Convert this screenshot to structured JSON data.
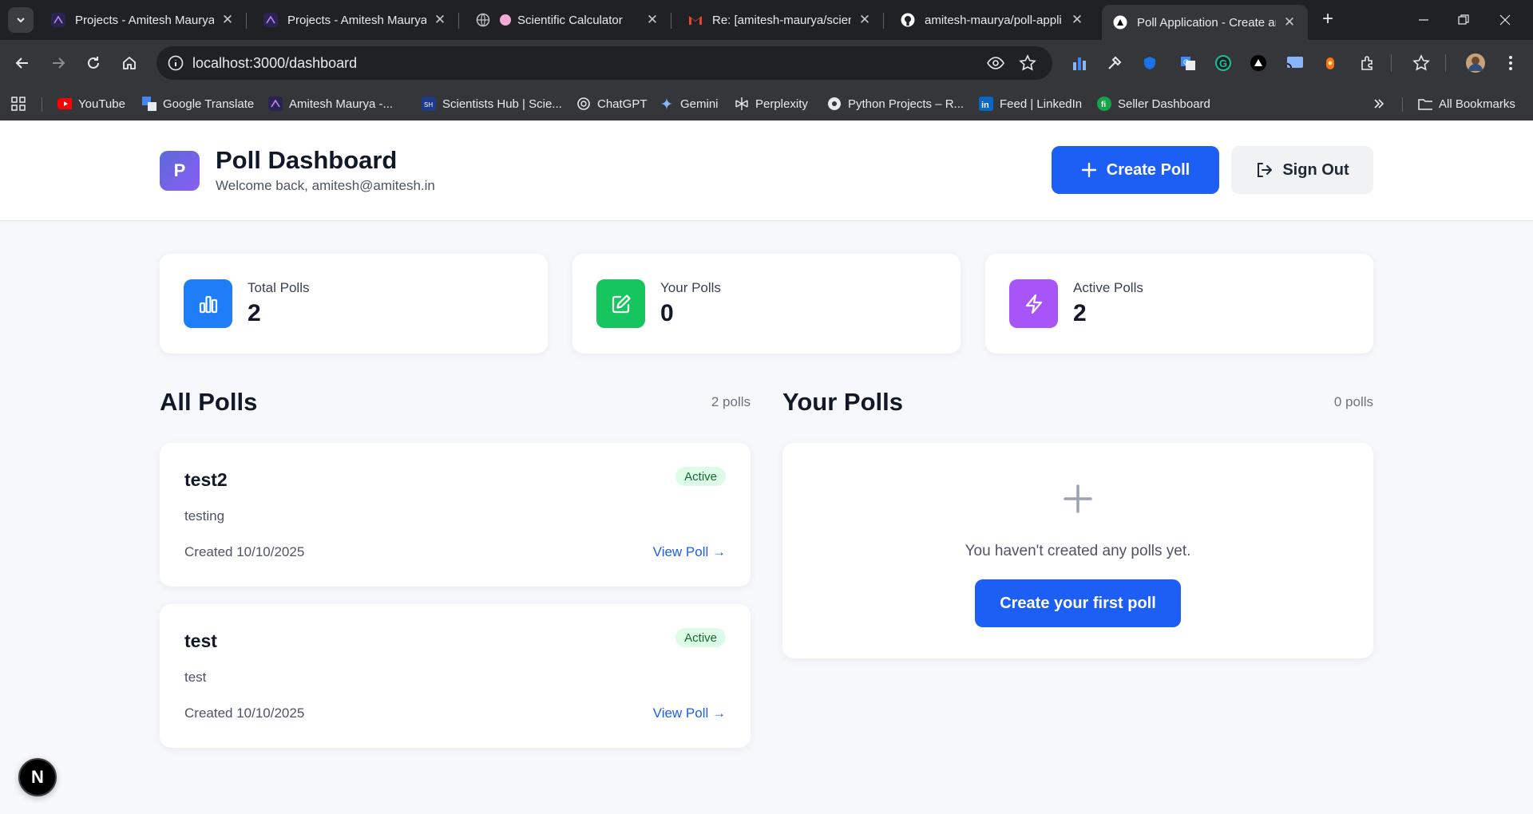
{
  "browser": {
    "tabs": [
      {
        "title": "Projects - Amitesh Maurya",
        "icon": "app-icon"
      },
      {
        "title": "Projects - Amitesh Maurya",
        "icon": "app-icon"
      },
      {
        "title": "Scientific Calculator",
        "icon": "globe-icon"
      },
      {
        "title": "Re: [amitesh-maurya/scientific",
        "icon": "gmail-icon"
      },
      {
        "title": "amitesh-maurya/poll-appli",
        "icon": "github-icon"
      },
      {
        "title": "Poll Application - Create an",
        "icon": "nextjs-icon"
      }
    ],
    "url": "localhost:3000/dashboard",
    "bookmarks": [
      {
        "label": "YouTube",
        "icon": "youtube-icon"
      },
      {
        "label": "Google Translate",
        "icon": "translate-icon"
      },
      {
        "label": "Amitesh Maurya -...",
        "icon": "app-icon"
      },
      {
        "label": "Scientists Hub | Scie...",
        "icon": "sh-icon"
      },
      {
        "label": "ChatGPT",
        "icon": "chatgpt-icon"
      },
      {
        "label": "Gemini",
        "icon": "gemini-icon"
      },
      {
        "label": "Perplexity",
        "icon": "perplexity-icon"
      },
      {
        "label": "Python Projects – R...",
        "icon": "python-icon"
      },
      {
        "label": "Feed | LinkedIn",
        "icon": "linkedin-icon"
      },
      {
        "label": "Seller Dashboard",
        "icon": "seller-icon"
      }
    ],
    "all_bookmarks_label": "All Bookmarks"
  },
  "header": {
    "logo_letter": "P",
    "title": "Poll Dashboard",
    "welcome": "Welcome back, amitesh@amitesh.in",
    "create_label": "Create Poll",
    "signout_label": "Sign Out"
  },
  "stats": [
    {
      "label": "Total Polls",
      "value": "2",
      "icon": "bar-chart-icon",
      "color": "#1f7ef7"
    },
    {
      "label": "Your Polls",
      "value": "0",
      "icon": "edit-icon",
      "color": "#16c55e"
    },
    {
      "label": "Active Polls",
      "value": "2",
      "icon": "lightning-icon",
      "color": "#a855f7"
    }
  ],
  "all_polls": {
    "title": "All Polls",
    "count": "2 polls",
    "items": [
      {
        "title": "test2",
        "description": "testing",
        "created": "Created 10/10/2025",
        "status": "Active",
        "link": "View Poll →"
      },
      {
        "title": "test",
        "description": "test",
        "created": "Created 10/10/2025",
        "status": "Active",
        "link": "View Poll →"
      }
    ]
  },
  "your_polls": {
    "title": "Your Polls",
    "count": "0 polls",
    "empty_text": "You haven't created any polls yet.",
    "cta_label": "Create your first poll"
  },
  "dev_badge": "N"
}
